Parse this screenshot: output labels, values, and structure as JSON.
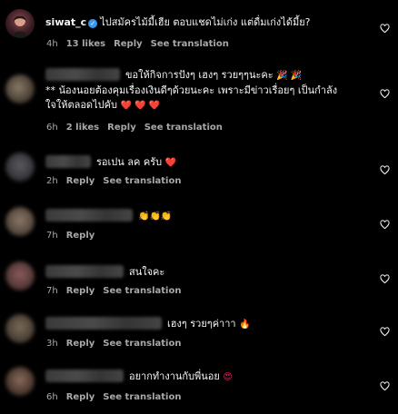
{
  "comments": [
    {
      "username": "siwat_c",
      "text": "ไปสมัครไม้มี้เฮีย ตอบแชดไม่เก่ง แต่ดื่มเก่งได้มี้ย?",
      "time": "4h",
      "likes": "13 likes",
      "reply": "Reply",
      "translate": "See translation"
    },
    {
      "text1": "ขอให้กิจการปังๆ เฮงๆ รวยๆๆนะคะ",
      "emoji1": "🎉 🎉",
      "text2": "** น้องนอยต้องคุมเรื่องเงินดีๆด้วยนะคะ เพราะมีข่าวเรื่อยๆ เป็นกำลัง",
      "text3": "ใจให้ตลอดไปคับ",
      "emoji3": "❤️ ❤️ ❤️",
      "time": "6h",
      "likes": "2 likes",
      "reply": "Reply",
      "translate": "See translation"
    },
    {
      "text": "รอเปน ลค ครับ",
      "emoji": "❤️",
      "time": "2h",
      "reply": "Reply",
      "translate": "See translation"
    },
    {
      "emoji": "👏👏👏",
      "time": "7h",
      "reply": "Reply"
    },
    {
      "text": "สนใจคะ",
      "time": "7h",
      "reply": "Reply",
      "translate": "See translation"
    },
    {
      "text": "เฮงๆ รวยๆค่าาา",
      "emoji": "🔥",
      "time": "3h",
      "reply": "Reply",
      "translate": "See translation"
    },
    {
      "text": "อยากทำงานกับพี่นอย",
      "emoji": "😍",
      "time": "6h",
      "reply": "Reply",
      "translate": "See translation"
    }
  ],
  "colors": {
    "background": "#000000",
    "text": "#f5f5f5",
    "meta": "#a8a8a8",
    "verified": "#3897f0"
  }
}
